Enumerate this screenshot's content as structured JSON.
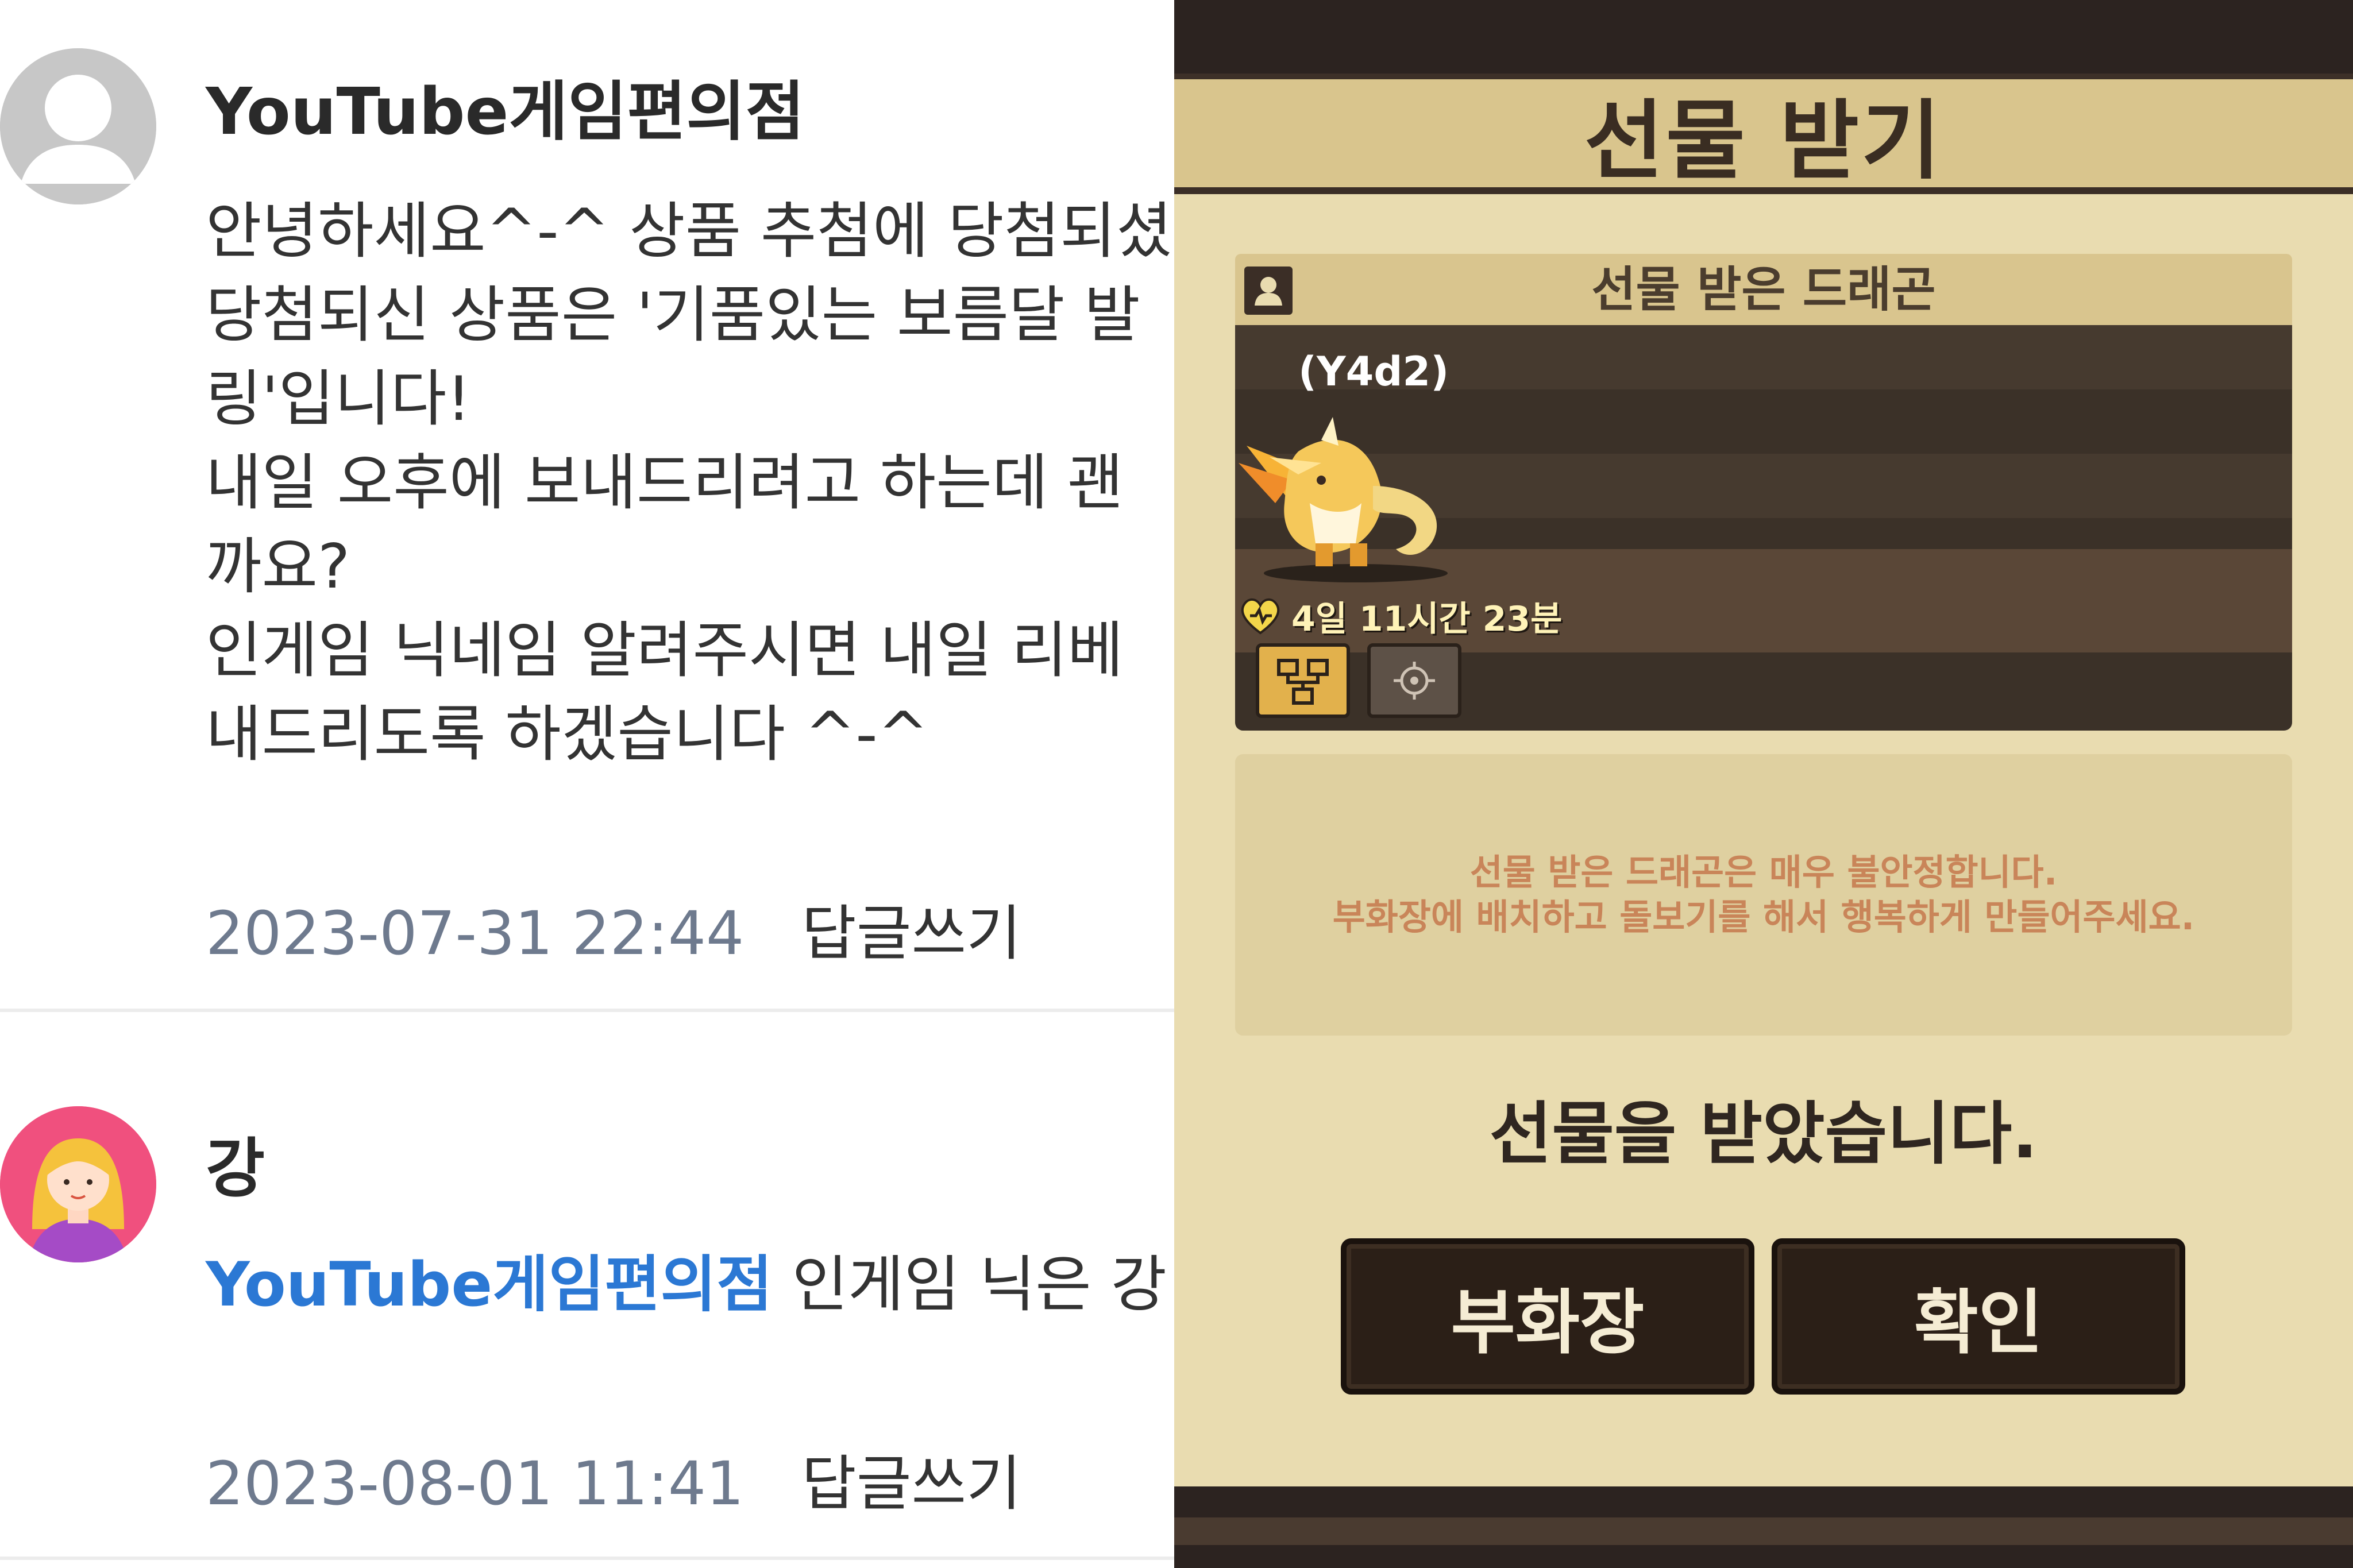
{
  "comments": [
    {
      "author": "YouTube게임편의점",
      "avatar_icon": "default-user-icon",
      "body_lines": [
        "안녕하세요^-^ 상품 추첨에 당첨되셨",
        "당첨되신 상품은 '기품있는 보름달 발",
        "링'입니다!",
        "내일 오후에 보내드리려고 하는데 괜",
        "까요?",
        "인게임 닉네임 알려주시면 내일 리베",
        "내드리도록 하겠습니다 ^-^"
      ],
      "date": "2023-07-31 22:44",
      "reply_label": "답글쓰기"
    },
    {
      "author": "강",
      "avatar_icon": "girl-avatar-icon",
      "mention": "YouTube게임편의점",
      "body": " 인게임 닉은 강",
      "date": "2023-08-01 11:41",
      "reply_label": "답글쓰기"
    }
  ],
  "game": {
    "title": "선물 받기",
    "card_label": "선물 받은 드래곤",
    "dragon_id": "(Y4d2)",
    "status": "4일 11시간 23분",
    "info_lines": [
      "선물 받은 드래곤은 매우 불안정합니다.",
      "부화장에 배치하고 돌보기를 해서 행복하게 만들어주세요."
    ],
    "result": "선물을 받았습니다.",
    "buttons": [
      "부화장",
      "확인"
    ],
    "icons": {
      "header": "user-icon",
      "heart": "heart-icon",
      "stats": "tree-icon",
      "target": "crosshair-icon"
    },
    "colors": {
      "frame": "#e9dcb0",
      "header": "#d9c58d",
      "button": "#2b1f17",
      "info_text": "#c98559"
    }
  },
  "colors": {
    "mention": "#2b78d4",
    "date": "#6e7a8e"
  }
}
